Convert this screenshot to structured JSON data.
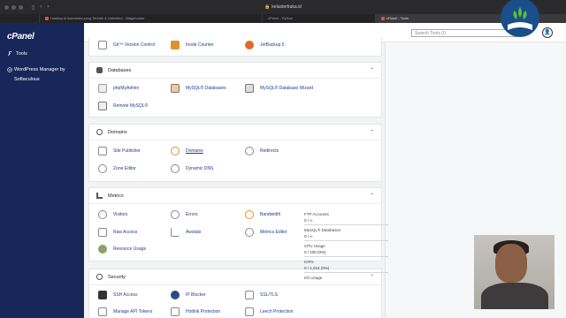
{
  "browser": {
    "url": "kelasterbuka.id",
    "tabs": [
      {
        "label": ""
      },
      {
        "label": "Hosting di Indonesia yang Terbaik & Unlimited - Niagahoster"
      },
      {
        "label": "cPanel - Python"
      },
      {
        "label": "cPanel - Tools"
      }
    ]
  },
  "sidebar": {
    "logo": "cPanel",
    "items": [
      {
        "label": "Tools",
        "icon": "wrench-icon"
      },
      {
        "label": "WordPress Manager by Softaculous",
        "icon": "wordpress-icon"
      }
    ]
  },
  "header": {
    "search_placeholder": "Search Tools (/)"
  },
  "sections": {
    "top": {
      "items": [
        {
          "label": "Git™ Version Control",
          "icon": "git-icon",
          "color": "#7a7a7a"
        },
        {
          "label": "Inode Counter",
          "icon": "inode-icon",
          "color": "#e0912c"
        },
        {
          "label": "JetBackup 5",
          "icon": "jetbackup-icon",
          "color": "#e06a2c"
        }
      ]
    },
    "databases": {
      "title": "Databases",
      "items": [
        {
          "label": "phpMyAdmin",
          "icon": "phpmyadmin-icon"
        },
        {
          "label": "MySQL® Databases",
          "icon": "mysql-icon"
        },
        {
          "label": "MySQL® Database Wizard",
          "icon": "mysql-wizard-icon"
        },
        {
          "label": "Remote MySQL®",
          "icon": "remote-mysql-icon"
        }
      ]
    },
    "domains": {
      "title": "Domains",
      "items": [
        {
          "label": "Site Publisher",
          "icon": "site-publisher-icon"
        },
        {
          "label": "Domains",
          "icon": "domains-icon"
        },
        {
          "label": "Redirects",
          "icon": "redirects-icon"
        },
        {
          "label": "Zone Editor",
          "icon": "zone-editor-icon"
        },
        {
          "label": "Dynamic DNS",
          "icon": "dynamic-dns-icon"
        }
      ]
    },
    "metrics": {
      "title": "Metrics",
      "items": [
        {
          "label": "Visitors",
          "icon": "visitors-icon"
        },
        {
          "label": "Errors",
          "icon": "errors-icon"
        },
        {
          "label": "Bandwidth",
          "icon": "bandwidth-icon"
        },
        {
          "label": "Raw Access",
          "icon": "raw-access-icon"
        },
        {
          "label": "Awstats",
          "icon": "awstats-icon"
        },
        {
          "label": "Metrics Editor",
          "icon": "metrics-editor-icon"
        },
        {
          "label": "Resource Usage",
          "icon": "resource-usage-icon"
        }
      ]
    },
    "security": {
      "title": "Security",
      "items": [
        {
          "label": "SSH Access",
          "icon": "ssh-icon"
        },
        {
          "label": "IP Blocker",
          "icon": "ip-blocker-icon"
        },
        {
          "label": "SSL/TLS",
          "icon": "ssl-icon"
        },
        {
          "label": "Manage API Tokens",
          "icon": "api-tokens-icon"
        },
        {
          "label": "Hotlink Protection",
          "icon": "hotlink-icon"
        },
        {
          "label": "Leech Protection",
          "icon": "leech-icon"
        }
      ]
    }
  },
  "stats": [
    {
      "label": "FTP Accounts",
      "value": "0 / ∞"
    },
    {
      "label": "MySQL® Databases",
      "value": "0 / ∞"
    },
    {
      "label": "CPU Usage",
      "value": "0 / 100   (0%)"
    },
    {
      "label": "IOPS",
      "value": "0 / 1,024   (0%)"
    },
    {
      "label": "I/O Usage",
      "value": ""
    }
  ],
  "colors": {
    "sidebar": "#17275a",
    "link": "#1e3e8a",
    "accent": "#e0912c"
  }
}
